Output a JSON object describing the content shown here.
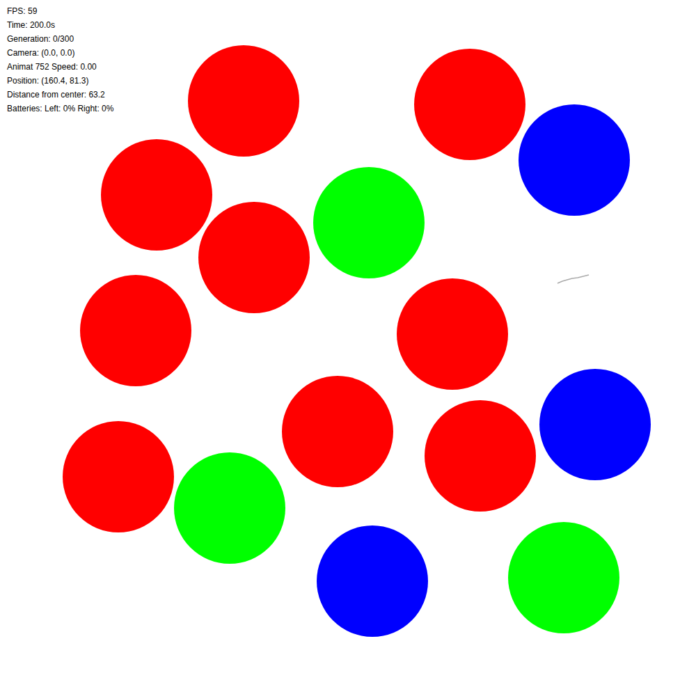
{
  "hud": [
    "FPS: 59",
    "Time: 200.0s",
    "Generation: 0/300",
    "Camera: (0.0, 0.0)",
    "Animat 752 Speed: 0.00",
    "Position: (160.4, 81.3)",
    "Distance from center: 63.2",
    "Batteries: Left: 0% Right: 0%"
  ],
  "objects": [
    {
      "color": "#ff0000"
    },
    {
      "color": "#ff0000"
    },
    {
      "color": "#ff0000"
    },
    {
      "color": "#ff0000"
    },
    {
      "color": "#ff0000"
    },
    {
      "color": "#ff0000"
    },
    {
      "color": "#ff0000"
    },
    {
      "color": "#ff0000"
    },
    {
      "color": "#ff0000"
    },
    {
      "color": "#00ff00"
    },
    {
      "color": "#00ff00"
    },
    {
      "color": "#00ff00"
    },
    {
      "color": "#0000ff"
    },
    {
      "color": "#0000ff"
    },
    {
      "color": "#0000ff"
    }
  ]
}
